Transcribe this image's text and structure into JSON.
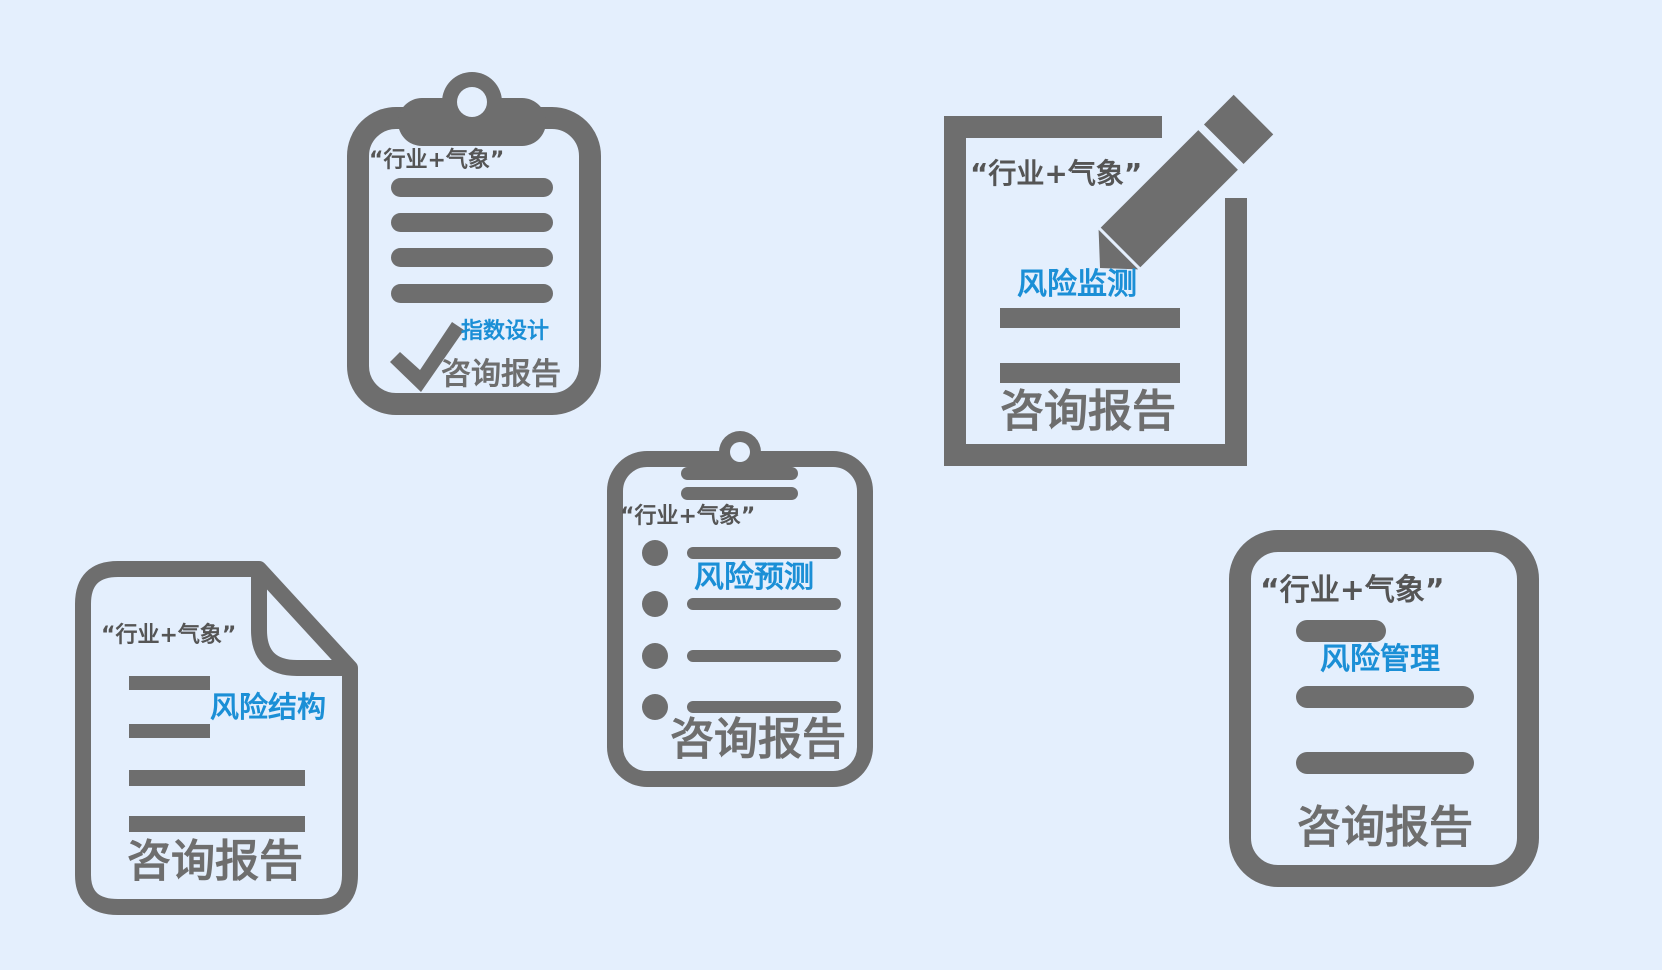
{
  "background": "#e4effd",
  "colors": {
    "icon": "#6e6e6e",
    "label": "#1b8fd6",
    "quote": "#555555"
  },
  "cards": [
    {
      "icon": "clipboard-check-icon",
      "quote": "“行业+气象”",
      "label": "指数设计",
      "title": "咨询报告"
    },
    {
      "icon": "document-pencil-icon",
      "quote": "“行业+气象”",
      "label": "风险监测",
      "title": "咨询报告"
    },
    {
      "icon": "clipboard-list-icon",
      "quote": "“行业+气象”",
      "label": "风险预测",
      "title": "咨询报告"
    },
    {
      "icon": "folded-document-icon",
      "quote": "“行业+气象”",
      "label": "风险结构",
      "title": "咨询报告"
    },
    {
      "icon": "rounded-document-icon",
      "quote": "“行业+气象”",
      "label": "风险管理",
      "title": "咨询报告"
    }
  ]
}
